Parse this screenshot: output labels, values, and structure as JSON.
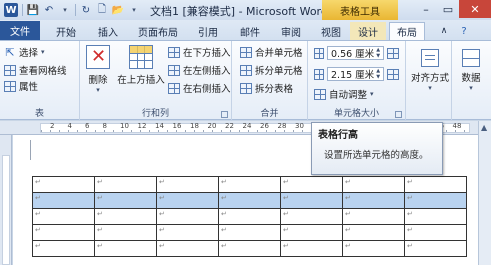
{
  "title_bar": {
    "title": "文档1 [兼容模式] - Microsoft Word",
    "context_tab": "表格工具",
    "word_logo": "W"
  },
  "tabs": [
    "文件",
    "开始",
    "插入",
    "页面布局",
    "引用",
    "邮件",
    "审阅",
    "视图",
    "设计",
    "布局"
  ],
  "ribbon": {
    "table_group": {
      "select": "选择",
      "gridlines": "查看网格线",
      "properties": "属性",
      "label": "表"
    },
    "rows_cols_group": {
      "delete": "删除",
      "insert_above": "在上方插入",
      "insert_below": "在下方插入",
      "insert_left": "在左侧插入",
      "insert_right": "在右侧插入",
      "label": "行和列"
    },
    "merge_group": {
      "merge_cells": "合并单元格",
      "split_cells": "拆分单元格",
      "split_table": "拆分表格",
      "label": "合并"
    },
    "cell_size_group": {
      "height_value": "0.56 厘米",
      "width_value": "2.15 厘米",
      "autofit": "自动调整",
      "label": "单元格大小"
    },
    "alignment": "对齐方式",
    "data": "数据"
  },
  "tooltip": {
    "title": "表格行高",
    "body": "设置所选单元格的高度。"
  },
  "ruler_numbers": [
    "2",
    "4",
    "6",
    "8",
    "10",
    "12",
    "14",
    "16",
    "18",
    "20",
    "22",
    "24",
    "26",
    "28",
    "30",
    "32",
    "34",
    "36",
    "38",
    "40",
    "42",
    "44",
    "46",
    "48"
  ],
  "table": {
    "cell_mark": "↵",
    "rows": 5,
    "cols": 7,
    "selected_row": 1
  }
}
